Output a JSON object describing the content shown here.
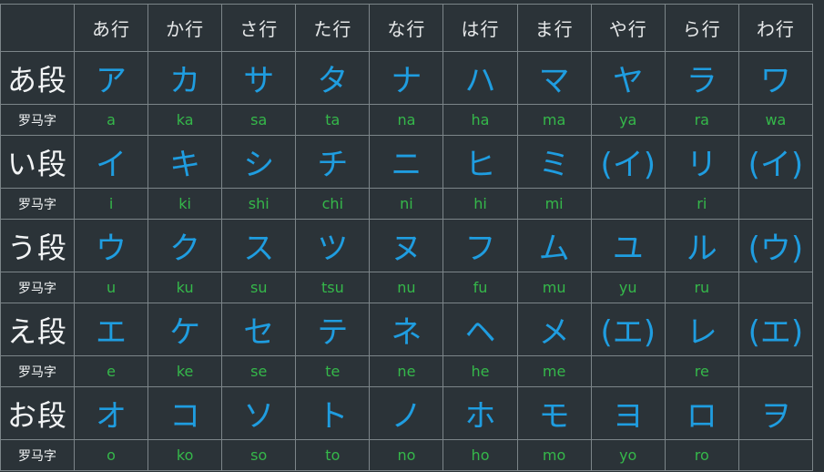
{
  "columns": [
    "あ行",
    "か行",
    "さ行",
    "た行",
    "な行",
    "は行",
    "ま行",
    "や行",
    "ら行",
    "わ行"
  ],
  "romaji_label": "罗马字",
  "rows": [
    {
      "label": "あ段",
      "kana": [
        "ア",
        "カ",
        "サ",
        "タ",
        "ナ",
        "ハ",
        "マ",
        "ヤ",
        "ラ",
        "ワ"
      ],
      "romaji": [
        "a",
        "ka",
        "sa",
        "ta",
        "na",
        "ha",
        "ma",
        "ya",
        "ra",
        "wa"
      ]
    },
    {
      "label": "い段",
      "kana": [
        "イ",
        "キ",
        "シ",
        "チ",
        "ニ",
        "ヒ",
        "ミ",
        "(イ)",
        "リ",
        "(イ)"
      ],
      "romaji": [
        "i",
        "ki",
        "shi",
        "chi",
        "ni",
        "hi",
        "mi",
        "",
        "ri",
        ""
      ]
    },
    {
      "label": "う段",
      "kana": [
        "ウ",
        "ク",
        "ス",
        "ツ",
        "ヌ",
        "フ",
        "ム",
        "ユ",
        "ル",
        "(ウ)"
      ],
      "romaji": [
        "u",
        "ku",
        "su",
        "tsu",
        "nu",
        "fu",
        "mu",
        "yu",
        "ru",
        ""
      ]
    },
    {
      "label": "え段",
      "kana": [
        "エ",
        "ケ",
        "セ",
        "テ",
        "ネ",
        "ヘ",
        "メ",
        "(エ)",
        "レ",
        "(エ)"
      ],
      "romaji": [
        "e",
        "ke",
        "se",
        "te",
        "ne",
        "he",
        "me",
        "",
        "re",
        ""
      ]
    },
    {
      "label": "お段",
      "kana": [
        "オ",
        "コ",
        "ソ",
        "ト",
        "ノ",
        "ホ",
        "モ",
        "ヨ",
        "ロ",
        "ヲ"
      ],
      "romaji": [
        "o",
        "ko",
        "so",
        "to",
        "no",
        "ho",
        "mo",
        "yo",
        "ro",
        ""
      ]
    }
  ],
  "colors": {
    "background": "#2b3338",
    "grid": "#7c8589",
    "header_text": "#e6e8e9",
    "kana_text": "#1f9de0",
    "romaji_text": "#35b84a"
  }
}
